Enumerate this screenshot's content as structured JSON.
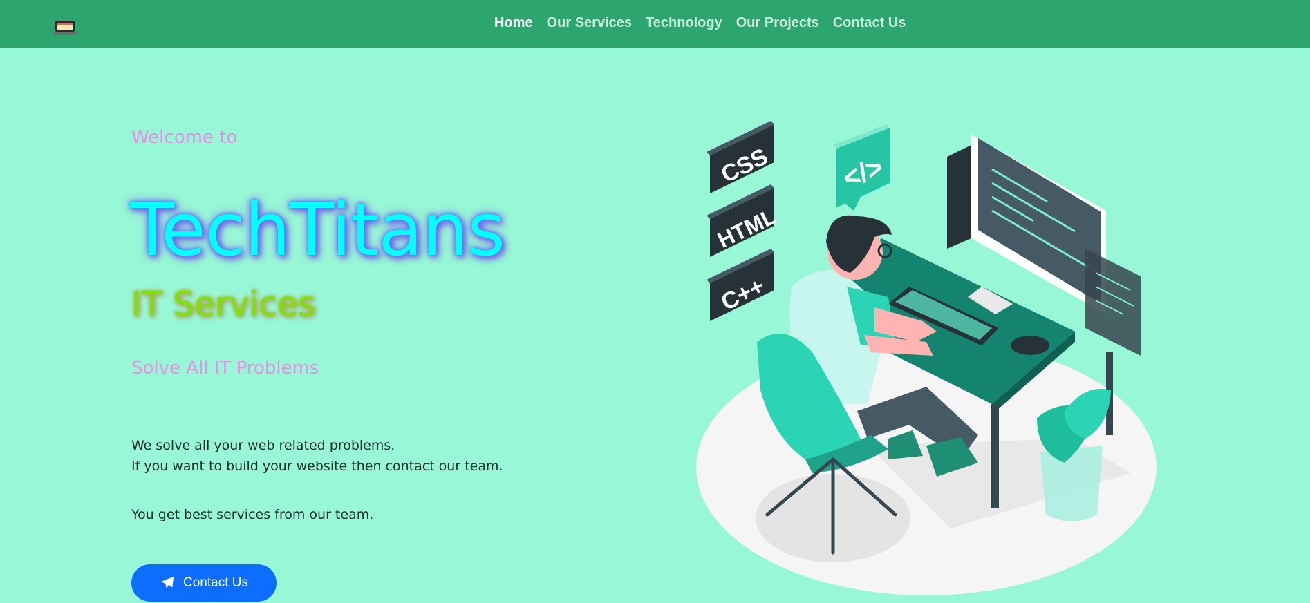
{
  "nav": {
    "logo_icon": "laptop-icon",
    "items": [
      {
        "label": "Home",
        "active": true
      },
      {
        "label": "Our Services",
        "active": false
      },
      {
        "label": "Technology",
        "active": false
      },
      {
        "label": "Our Projects",
        "active": false
      },
      {
        "label": "Contact Us",
        "active": false
      }
    ]
  },
  "hero": {
    "welcome": "Welcome to",
    "brand": "TechTitans",
    "sub_brand": "IT Services",
    "tagline": "Solve All IT Problems",
    "desc_line1": "We solve all your web related problems.",
    "desc_line2": "If you want to build your website then contact our team.",
    "desc_line3": "You get best services from our team.",
    "cta_label": "Contact Us",
    "cta_icon": "paper-plane-icon"
  },
  "illustration": {
    "tags": [
      "CSS",
      "HTML",
      "C++"
    ],
    "code_bubble": "</>"
  },
  "colors": {
    "nav_bg": "#2ca66e",
    "page_bg": "#98f7d6",
    "accent_pink": "#e98de6",
    "brand_cyan": "#00ffff",
    "brand_green": "#7be400",
    "button_blue": "#0d6efd"
  }
}
